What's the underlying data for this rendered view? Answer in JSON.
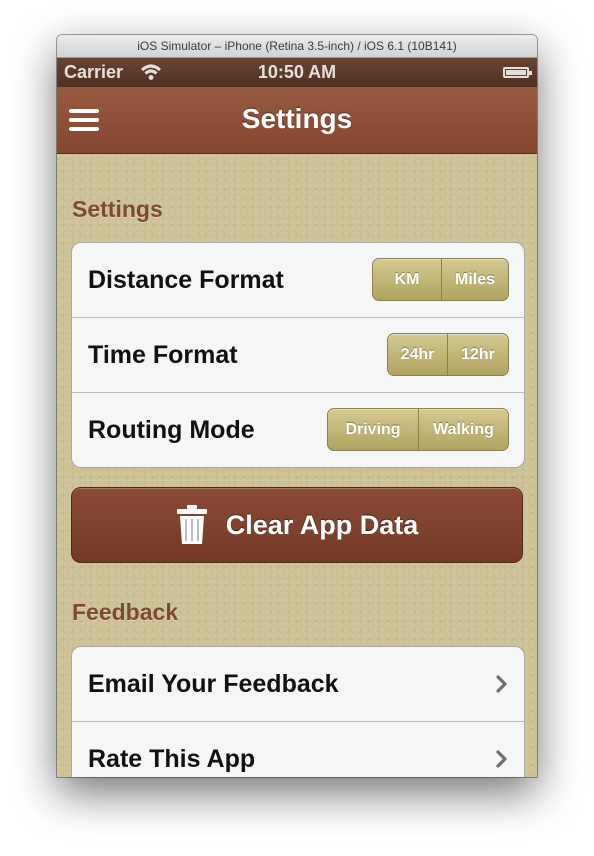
{
  "window": {
    "title": "iOS Simulator – iPhone (Retina 3.5-inch) / iOS 6.1 (10B141)"
  },
  "status_bar": {
    "carrier": "Carrier",
    "time": "10:50 AM"
  },
  "nav_bar": {
    "title": "Settings"
  },
  "settings_section": {
    "header": "Settings",
    "rows": [
      {
        "label": "Distance Format",
        "options": [
          "KM",
          "Miles"
        ]
      },
      {
        "label": "Time Format",
        "options": [
          "24hr",
          "12hr"
        ]
      },
      {
        "label": "Routing Mode",
        "options": [
          "Driving",
          "Walking"
        ]
      }
    ]
  },
  "clear_button": {
    "label": "Clear App Data"
  },
  "feedback_section": {
    "header": "Feedback",
    "rows": [
      {
        "label": "Email Your Feedback"
      },
      {
        "label": "Rate This App"
      }
    ]
  },
  "colors": {
    "nav_bar": "#8f5038",
    "status_bar": "#5c392a",
    "accent": "#7e4a30",
    "segment": "#c4b87a",
    "background": "#cdc296"
  }
}
